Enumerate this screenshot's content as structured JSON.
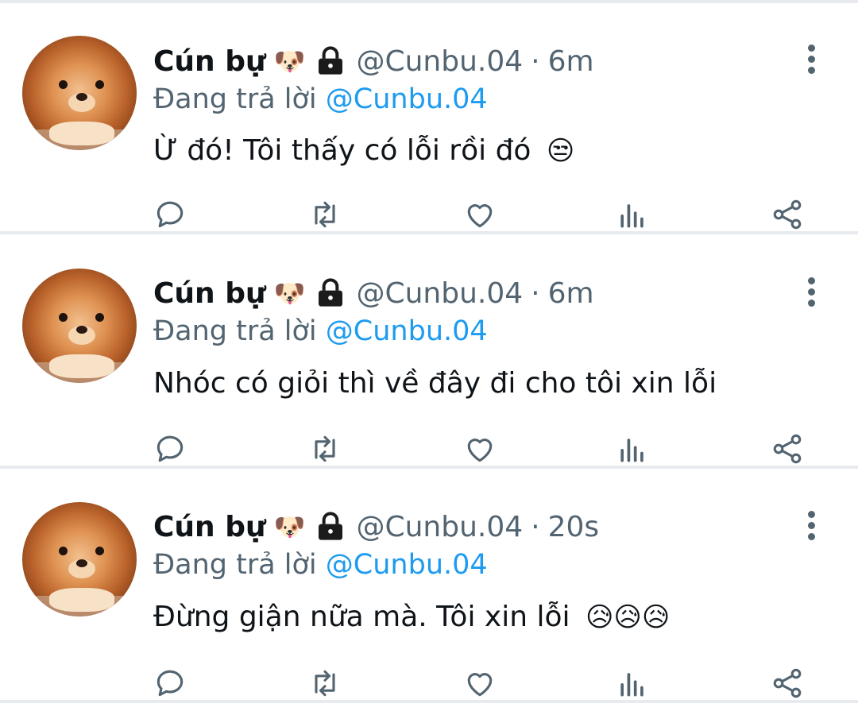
{
  "tweets": [
    {
      "author": "Cún bự",
      "name_emoji": "🐶",
      "handle": "@Cunbu.04",
      "separator": "·",
      "time": "6m",
      "reply_prefix": "Đang trả lời",
      "reply_to": "@Cunbu.04",
      "text": "Ừ đó! Tôi thấy có lỗi rồi đó",
      "text_emoji": "😒"
    },
    {
      "author": "Cún bự",
      "name_emoji": "🐶",
      "handle": "@Cunbu.04",
      "separator": "·",
      "time": "6m",
      "reply_prefix": "Đang trả lời",
      "reply_to": "@Cunbu.04",
      "text": "Nhóc có giỏi thì về đây đi cho tôi xin lỗi",
      "text_emoji": ""
    },
    {
      "author": "Cún bự",
      "name_emoji": "🐶",
      "handle": "@Cunbu.04",
      "separator": "·",
      "time": "20s",
      "reply_prefix": "Đang trả lời",
      "reply_to": "@Cunbu.04",
      "text": "Đừng giận nữa mà. Tôi xin lỗi",
      "text_emoji": "😥😥😥"
    }
  ],
  "icons": {
    "reply": "reply-icon",
    "retweet": "retweet-icon",
    "like": "heart-icon",
    "analytics": "analytics-icon",
    "share": "share-icon",
    "more": "more-vertical-icon",
    "lock": "lock-icon"
  },
  "colors": {
    "text": "#0f1419",
    "secondary": "#536471",
    "link": "#1d9bf0",
    "divider": "#e7eaee"
  }
}
